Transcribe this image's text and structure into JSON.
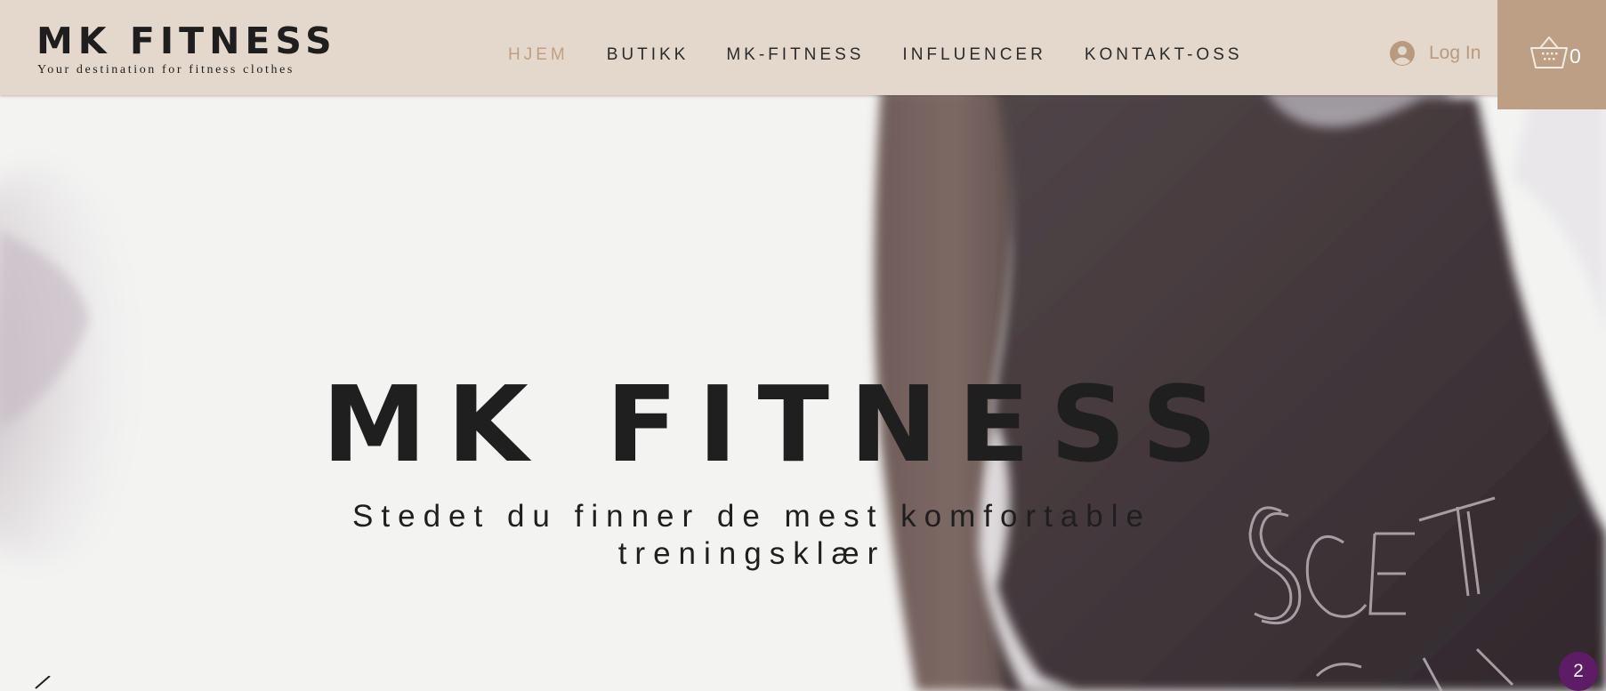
{
  "header": {
    "brand_name": "MK FITNESS",
    "brand_tagline": "Your destination for fitness clothes"
  },
  "nav": {
    "items": [
      {
        "label": "HJEM",
        "active": true
      },
      {
        "label": "BUTIKK",
        "active": false
      },
      {
        "label": "MK-FITNESS",
        "active": false
      },
      {
        "label": "INFLUENCER",
        "active": false
      },
      {
        "label": "KONTAKT-OSS",
        "active": false
      }
    ]
  },
  "login": {
    "label": "Log In",
    "icon": "user-avatar-icon"
  },
  "cart": {
    "count": "0",
    "icon": "shopping-basket-icon"
  },
  "hero": {
    "title": "MK FITNESS",
    "subtitle_line1": "Stedet du finner de mest komfortable",
    "subtitle_line2": "treningsklær",
    "background_text": "SOCIETY"
  },
  "notification": {
    "count": "2"
  },
  "colors": {
    "header_bg": "#e4d8cc",
    "accent": "#c09f82",
    "cart_bg": "#bd9f86",
    "text_dark": "#1f1f1f",
    "badge_bg": "#5e1c66"
  }
}
